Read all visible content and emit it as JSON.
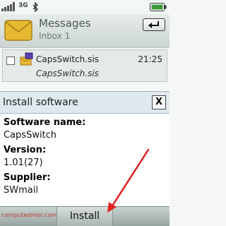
{
  "status_bar": {
    "network": "3G",
    "signal_icon": "signal-bars-icon",
    "bluetooth_icon": "bluetooth-icon",
    "battery_icon": "battery-icon"
  },
  "header": {
    "title": "Messages",
    "subtitle": "Inbox 1",
    "icon": "envelope-icon",
    "back_icon": "back-arrow-icon"
  },
  "message": {
    "name": "CapsSwitch.sis",
    "time": "21:25",
    "description": "CapsSwitch.sis",
    "icon": "sis-package-icon"
  },
  "dialog": {
    "title": "Install software",
    "close_label": "X",
    "fields": [
      {
        "label": "Software name:",
        "value": "CapsSwitch"
      },
      {
        "label": "Version:",
        "value": "1.01(27)"
      },
      {
        "label": "Supplier:",
        "value": "SWmail"
      }
    ]
  },
  "softkeys": {
    "center": "Install"
  },
  "watermark": "computedmbr.com",
  "colors": {
    "arrow": "#e02020",
    "dialog_header": "#dfe9ee",
    "envelope": "#e8b830"
  }
}
